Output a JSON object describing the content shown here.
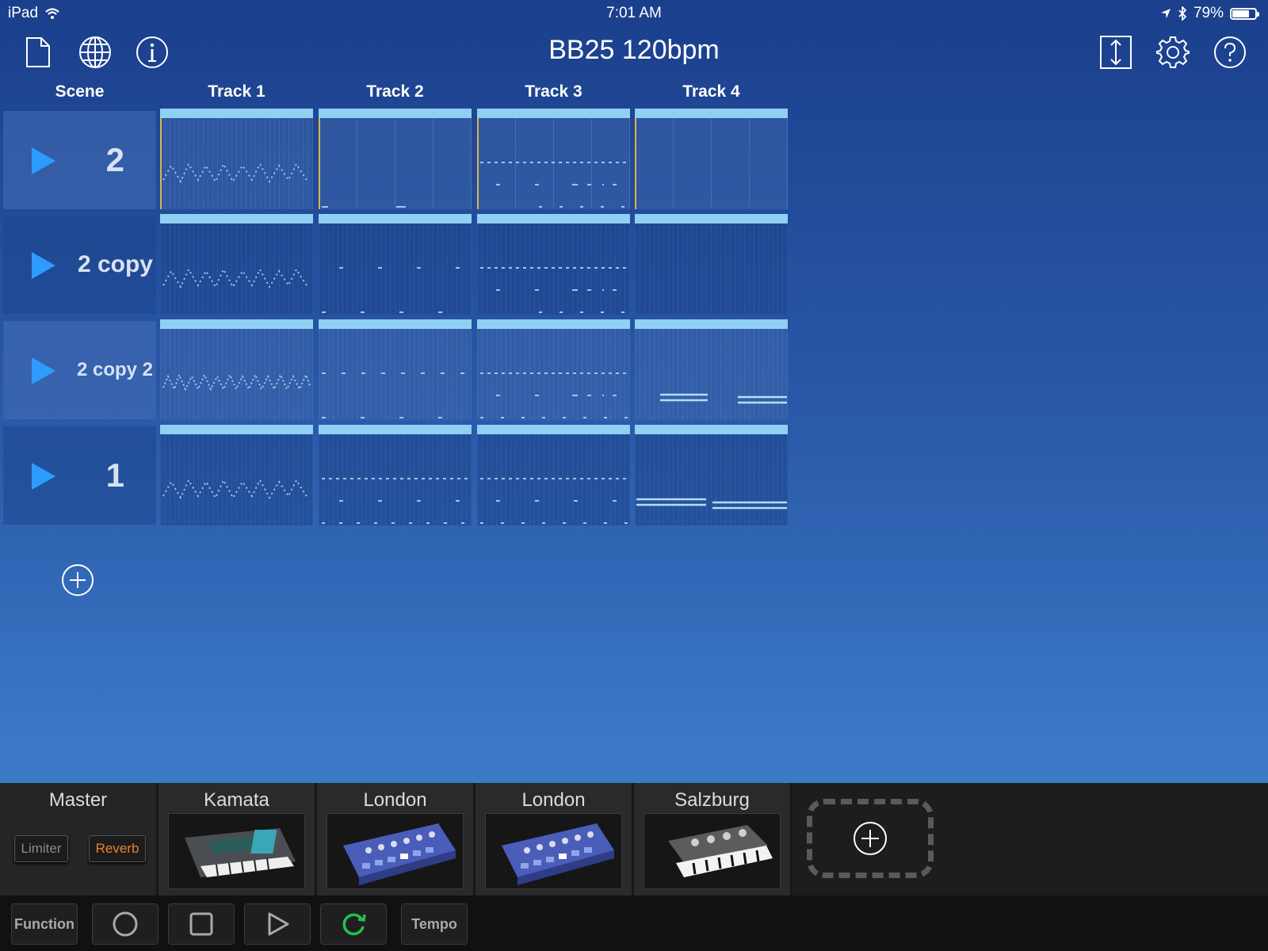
{
  "status_bar": {
    "device": "iPad",
    "time": "7:01 AM",
    "battery": "79%",
    "battery_level": 0.79
  },
  "toolbar": {
    "title": "BB25 120bpm",
    "left_icons": [
      "document-icon",
      "globe-icon",
      "info-icon"
    ],
    "right_icons": [
      "resize-vertical-icon",
      "gear-icon",
      "help-icon"
    ]
  },
  "grid": {
    "scene_header": "Scene",
    "track_headers": [
      "Track 1",
      "Track 2",
      "Track 3",
      "Track 4"
    ],
    "scenes": [
      {
        "label": "2"
      },
      {
        "label": "2 copy"
      },
      {
        "label": "2 copy 2"
      },
      {
        "label": "1"
      }
    ]
  },
  "rack": {
    "master": {
      "label": "Master",
      "limiter": "Limiter",
      "reverb": "Reverb"
    },
    "instruments": [
      "Kamata",
      "London",
      "London",
      "Salzburg"
    ]
  },
  "transport": {
    "function": "Function",
    "tempo": "Tempo",
    "icons": [
      "record-icon",
      "stop-icon",
      "play-icon",
      "loop-icon"
    ]
  },
  "colors": {
    "accent_blue": "#2e9bff",
    "clip_bar": "#8fd0f3",
    "reverb_orange": "#e8812e",
    "loop_green": "#26c04a",
    "playhead": "#d8b64a"
  }
}
